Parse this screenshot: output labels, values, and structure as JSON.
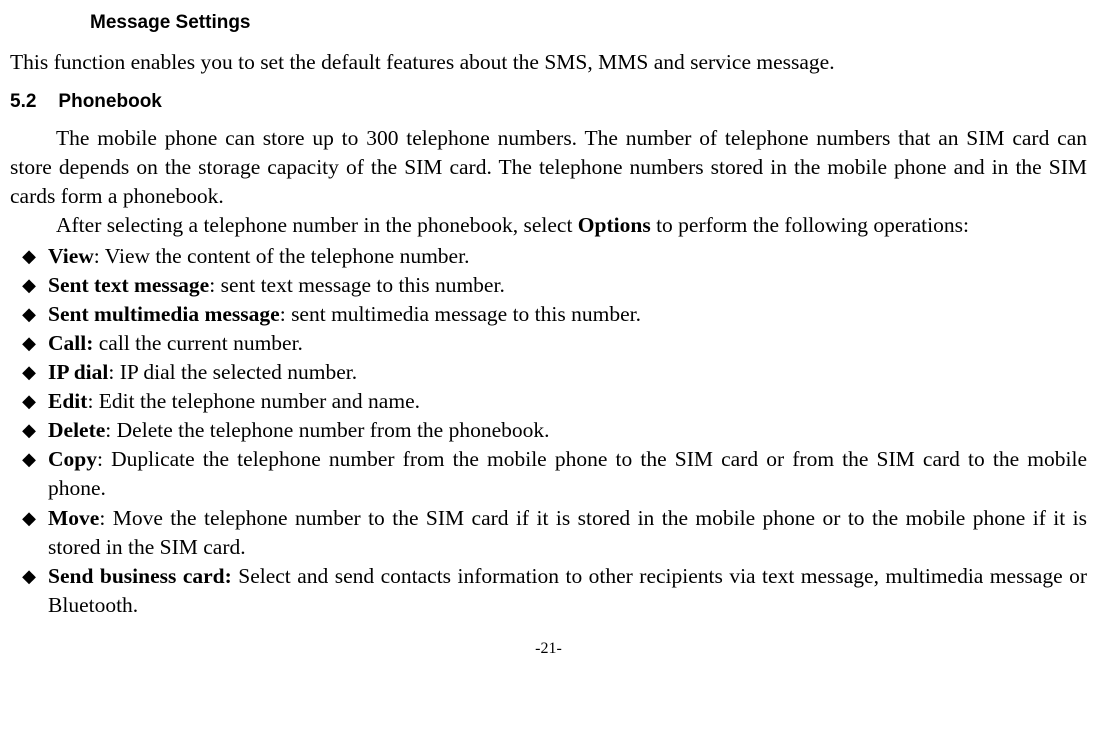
{
  "heading3": "Message Settings",
  "intro": "This function enables you to set the default features about the SMS, MMS and service message.",
  "sectionNumber": "5.2",
  "sectionTitle": "Phonebook",
  "para1": "The mobile phone can store up to 300 telephone numbers. The number of telephone numbers that an SIM card can store depends on the storage capacity of the SIM card. The telephone numbers stored in the mobile phone and in the SIM cards form a phonebook.",
  "para2_pre": "After selecting a telephone number in the phonebook, select ",
  "para2_bold": "Options",
  "para2_post": " to perform the following operations:",
  "bullets": [
    {
      "label": "View",
      "sep": ": ",
      "desc": "View the content of the telephone number."
    },
    {
      "label": "Sent text message",
      "sep": ": ",
      "desc": "sent text message to this number."
    },
    {
      "label": "Sent multimedia message",
      "sep": ": ",
      "desc": "sent multimedia message to this number."
    },
    {
      "label": "Call:",
      "sep": " ",
      "desc": "call the current number."
    },
    {
      "label": "IP dial",
      "sep": ": ",
      "desc": "IP dial the selected number."
    },
    {
      "label": "Edit",
      "sep": ": ",
      "desc": "Edit the telephone number and name."
    },
    {
      "label": "Delete",
      "sep": ": ",
      "desc": "Delete the telephone number from the phonebook."
    },
    {
      "label": "Copy",
      "sep": ": ",
      "desc": "Duplicate the telephone number from the mobile phone to the SIM card or from the SIM card to the mobile phone."
    },
    {
      "label": "Move",
      "sep": ": ",
      "desc": "Move the telephone number to the SIM card if it is stored in the mobile phone or to the mobile phone if it is stored in the SIM card."
    },
    {
      "label": "Send business card:",
      "sep": " ",
      "desc": "Select and send contacts information to other recipients via text message, multimedia message or Bluetooth."
    }
  ],
  "pageNumber": "-21-"
}
